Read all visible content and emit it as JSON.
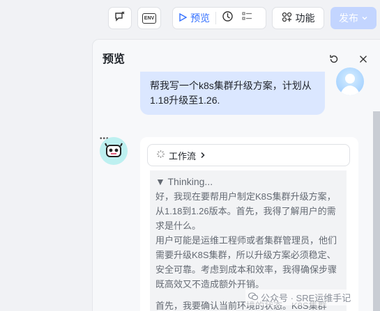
{
  "toolbar": {
    "icon_buttons": [
      "chat-clear-icon",
      "env-icon"
    ],
    "env_label": "ENV",
    "preview_label": "预览",
    "feature_label": "功能",
    "publish_label": "发布",
    "accent": "#3370ff"
  },
  "panel": {
    "title": "预览",
    "refresh_icon": "refresh-icon",
    "close_icon": "close-icon"
  },
  "user_message": {
    "text": "帮我写一个k8s集群升级方案，计划从1.18升级至1.26."
  },
  "bot_message": {
    "workflow_label": "工作流",
    "thinking_header": "▼ Thinking...",
    "thinking_paragraphs": [
      "好，我现在要帮用户制定K8S集群升级方案，从1.18到1.26版本。首先，我得了解用户的需求是什么。",
      "用户可能是运维工程师或者集群管理员，他们需要升级K8S集群，所以升级方案必须稳定、安全可靠。考虑到成本和效率，我得确保步骤既高效又不造成额外开销。",
      "首先，我要确认当前环境的状态。K8S集群"
    ]
  },
  "watermark": {
    "text": "公众号 · SRE运维手记"
  }
}
